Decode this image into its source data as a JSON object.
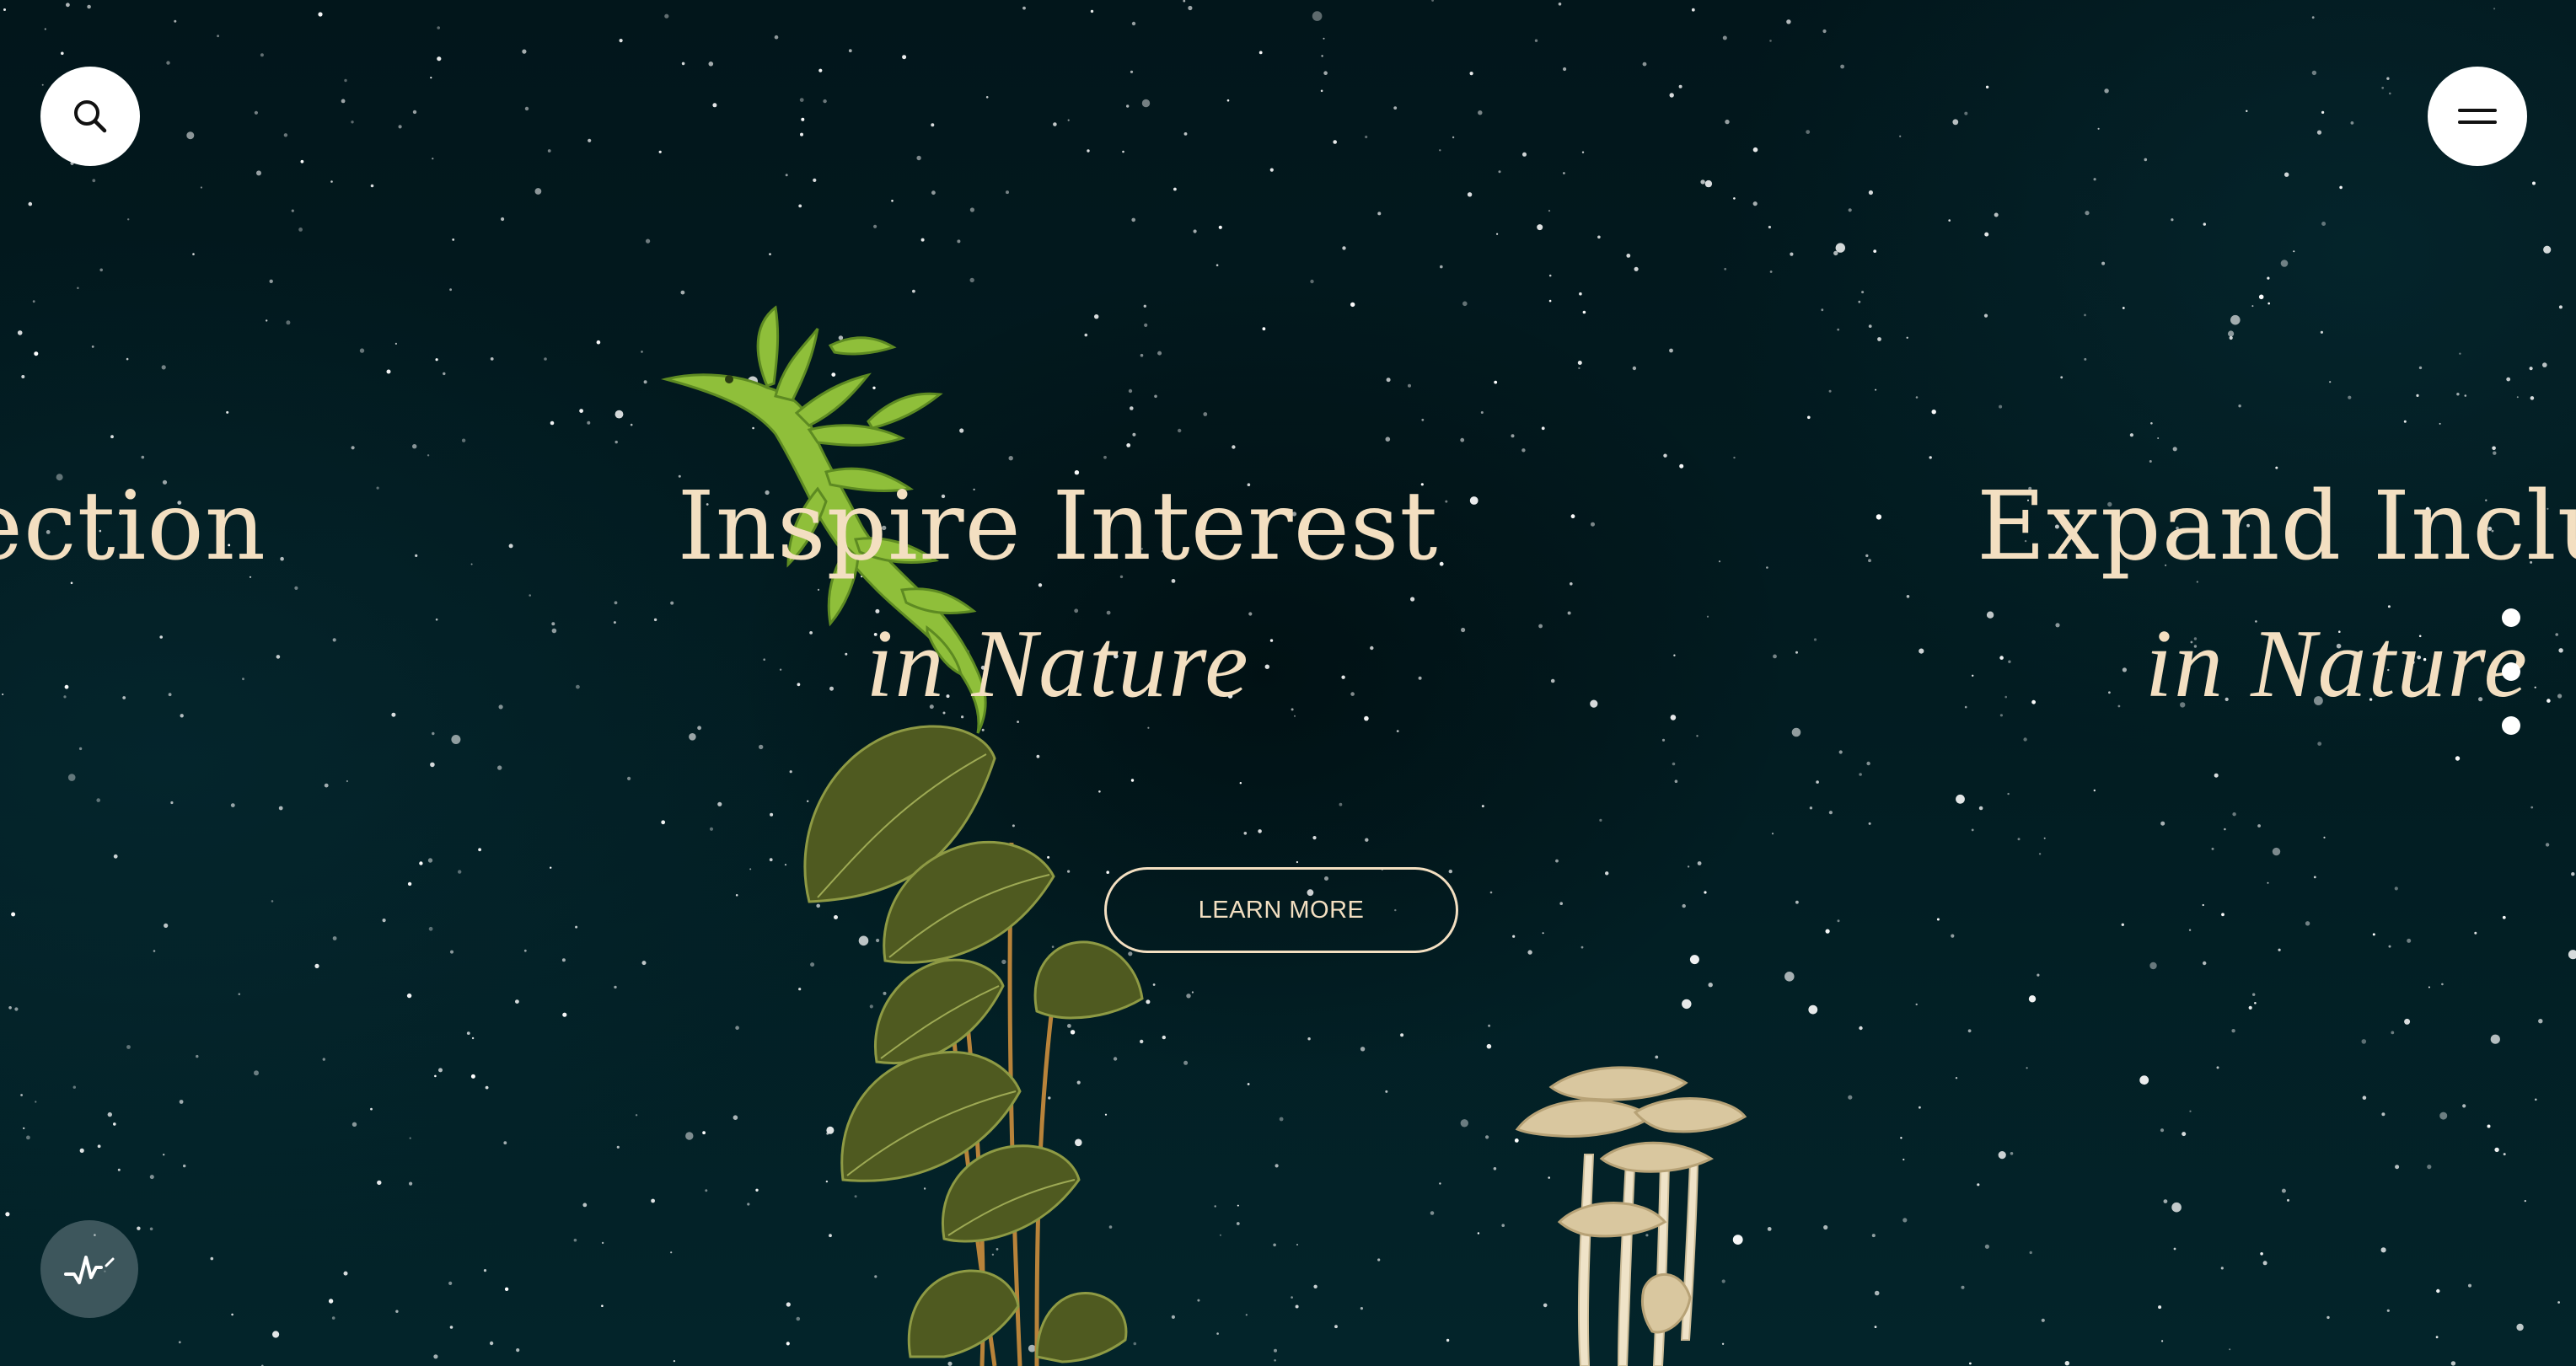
{
  "header": {
    "search_icon": "search-icon",
    "menu_icon": "hamburger-menu-icon"
  },
  "slides": {
    "previous": {
      "title_fragment": "ection"
    },
    "current": {
      "title": "Inspire Interest",
      "subtitle": "in Nature"
    },
    "next": {
      "title_fragment": "Expand Inclus",
      "subtitle": "in Nature"
    }
  },
  "cta": {
    "label": "LEARN MORE"
  },
  "pagination": {
    "count": 3
  },
  "footer": {
    "audio_icon": "sound-wave-icon"
  },
  "colors": {
    "background": "#021b20",
    "headline": "#f3dfc1",
    "button_fill": "#ffffff",
    "audio_button": "#6e8287"
  }
}
